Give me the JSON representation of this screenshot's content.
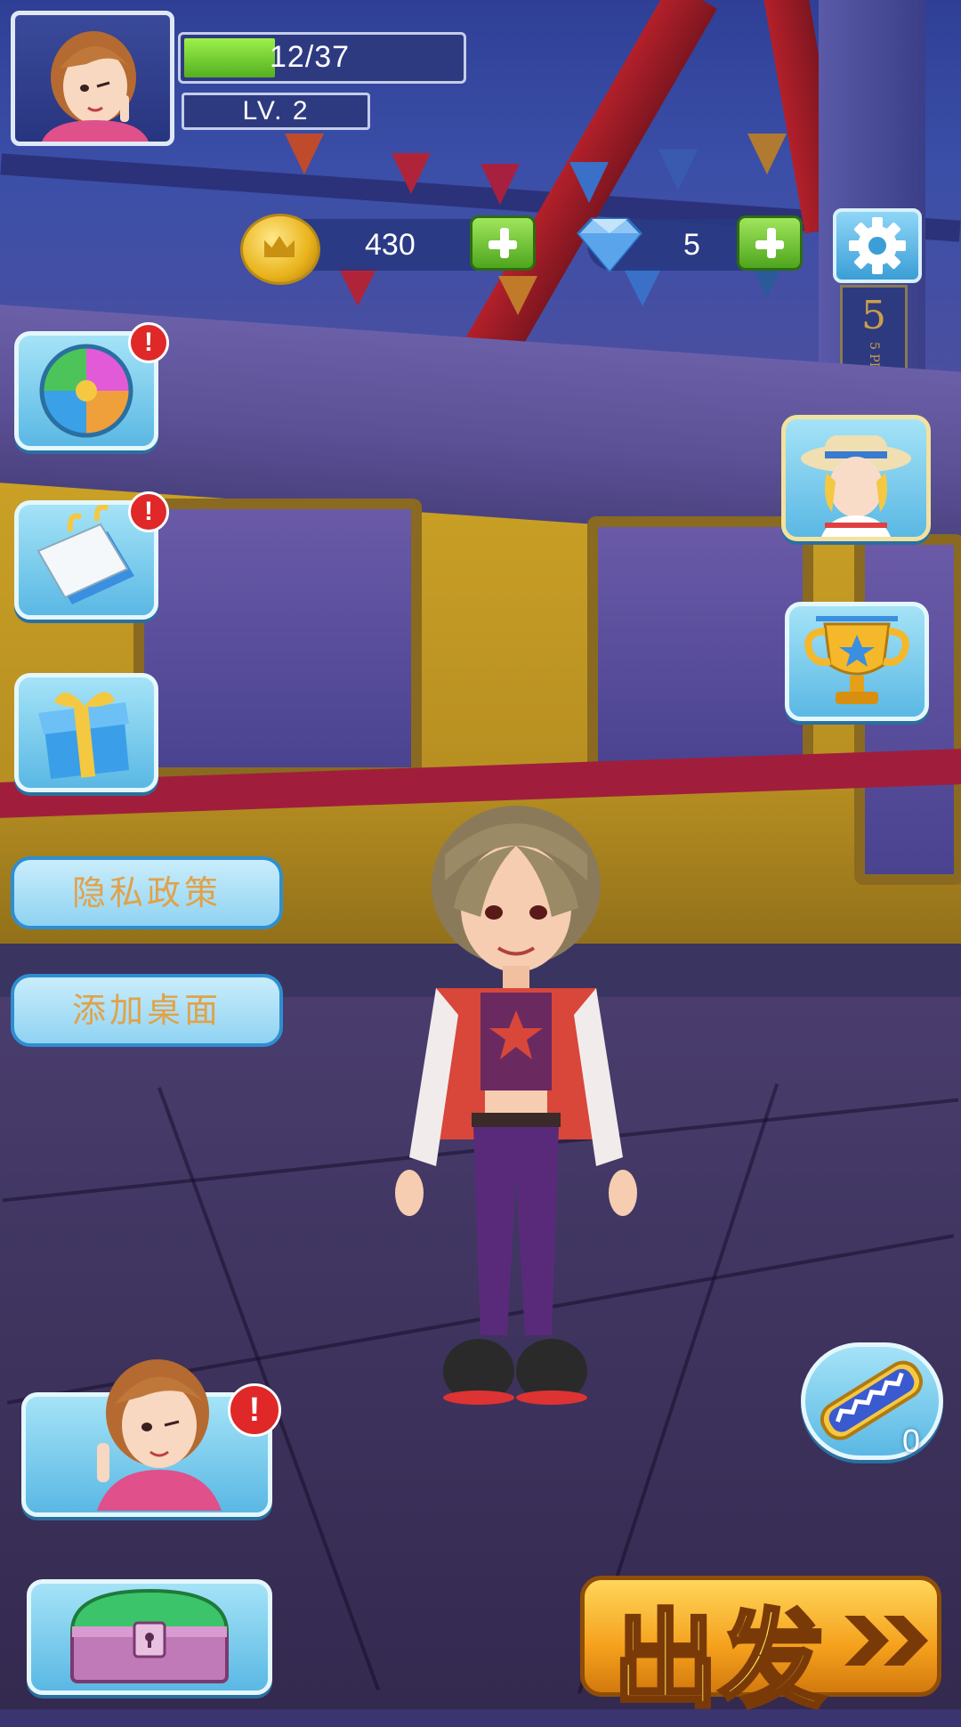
{
  "player": {
    "xp": "12/37",
    "xp_fraction": 0.32,
    "level": "LV. 2"
  },
  "currency": {
    "coins": "430",
    "gems": "5"
  },
  "side_menu": {
    "privacy_label": "隐私政策",
    "add_desktop_label": "添加桌面"
  },
  "badges": {
    "alert": "!"
  },
  "background": {
    "platform_sign": "5 PLATFORM"
  },
  "hoverboard": {
    "count": "0"
  },
  "start_button": {
    "label": "出发"
  },
  "colors": {
    "accent_blue": "#5ab8e4",
    "plus_green": "#4ea61e",
    "alert_red": "#e02828",
    "go_orange": "#f5a01c",
    "label_gold": "#e0a24a"
  },
  "icons": [
    "settings-gear-icon",
    "lucky-wheel-icon",
    "calendar-icon",
    "gift-icon",
    "character-outfit-icon",
    "trophy-icon",
    "hoverboard-icon",
    "treasure-chest-icon",
    "coin-icon",
    "gem-icon"
  ]
}
